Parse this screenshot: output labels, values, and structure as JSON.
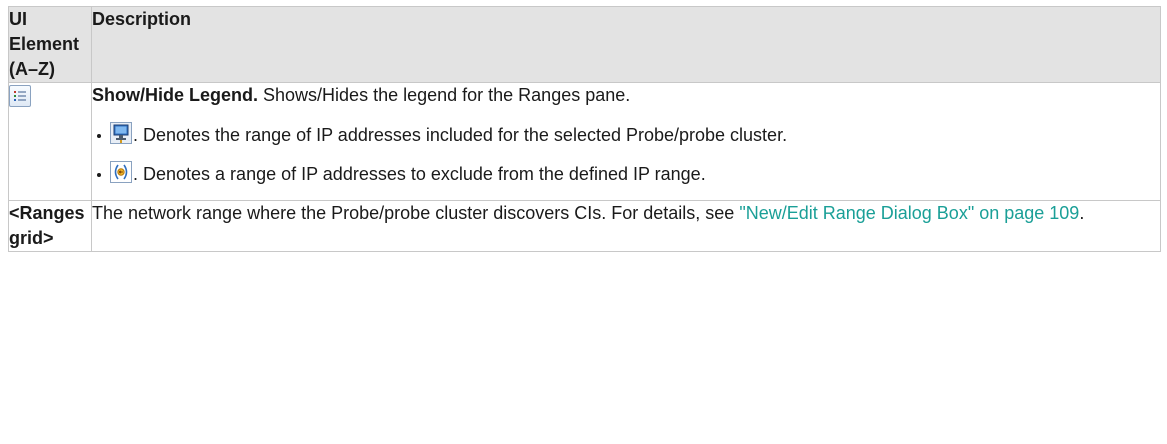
{
  "table": {
    "header": {
      "col1_lines": [
        "UI",
        "Element",
        "(A–Z)"
      ],
      "col2": "Description"
    },
    "rows": [
      {
        "icon": "legend-list-icon",
        "title": "Show/Hide Legend.",
        "text": " Shows/Hides the legend for the Ranges pane.",
        "bullets": [
          {
            "icon": "probe-computer-icon",
            "text": ". Denotes the range of IP addresses included for the selected Probe/probe cluster."
          },
          {
            "icon": "exclude-range-icon",
            "text": ". Denotes a range of IP addresses to exclude from the defined IP range."
          }
        ]
      },
      {
        "element_lines": [
          "<Ranges",
          "grid>"
        ],
        "text": "The network range where the Probe/probe cluster discovers CIs. For details, see ",
        "link": "\"New/Edit Range Dialog Box\" on page 109",
        "suffix": "."
      }
    ]
  },
  "colors": {
    "header_bg": "#e3e3e3",
    "border": "#c8c8c8",
    "link": "#1a9f97"
  }
}
